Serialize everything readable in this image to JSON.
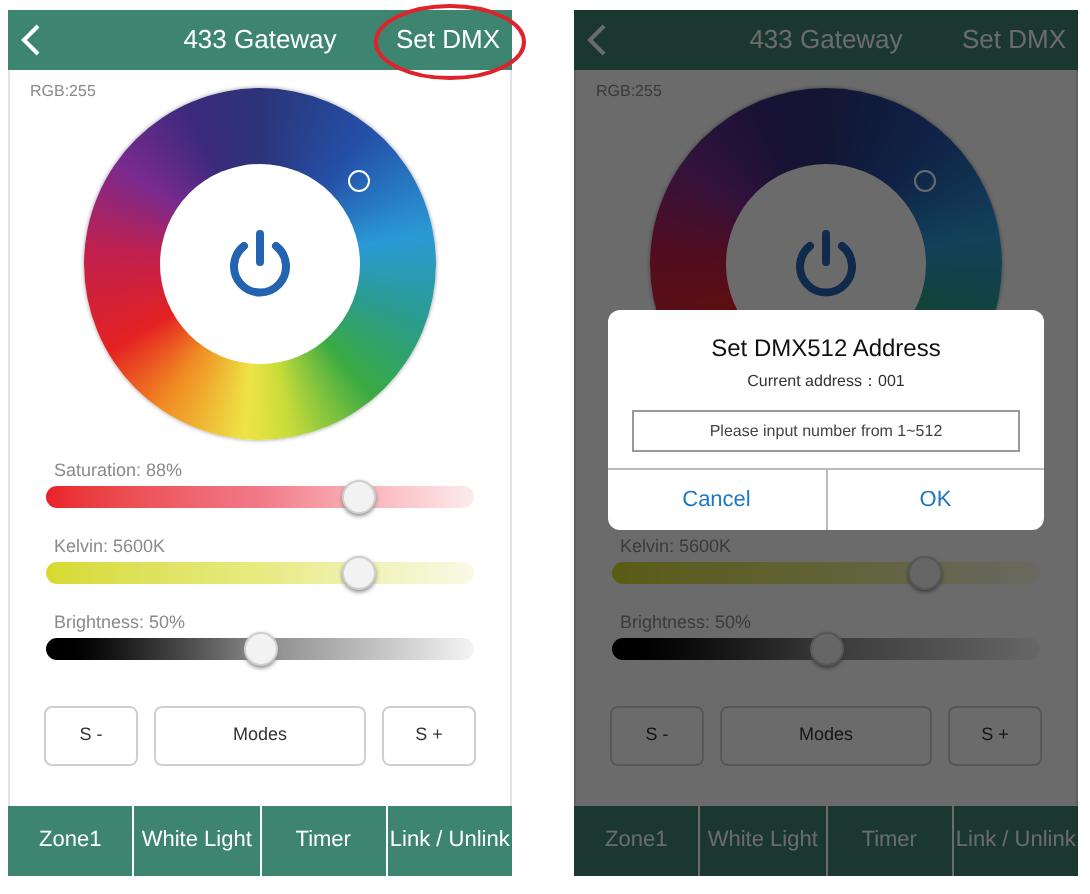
{
  "screens": [
    {
      "header": {
        "title": "433 Gateway",
        "action": "Set DMX",
        "action_highlighted": true
      },
      "rgb_label": "RGB:255",
      "sliders": [
        {
          "kind": "saturation",
          "label": "Saturation: 88%",
          "level": 0.73
        },
        {
          "kind": "kelvin",
          "label": "Kelvin: 5600K",
          "level": 0.73
        },
        {
          "kind": "brightness",
          "label": "Brightness: 50%",
          "level": 0.5
        }
      ],
      "buttons": [
        "S -",
        "Modes",
        "S +"
      ],
      "tabs": [
        "Zone1",
        "White Light",
        "Timer",
        "Link / Unlink"
      ]
    },
    {
      "header": {
        "title": "433 Gateway",
        "action": "Set DMX",
        "action_highlighted": false
      },
      "rgb_label": "RGB:255",
      "sliders": [
        {
          "kind": "kelvin",
          "label": "Kelvin: 5600K",
          "level": 0.73
        },
        {
          "kind": "brightness",
          "label": "Brightness: 50%",
          "level": 0.5
        }
      ],
      "buttons": [
        "S -",
        "Modes",
        "S +"
      ],
      "tabs": [
        "Zone1",
        "White Light",
        "Timer",
        "Link / Unlink"
      ],
      "dialog": {
        "title": "Set DMX512 Address",
        "subtitle": "Current address：001",
        "input": {
          "placeholder": "Please input number from 1~512"
        },
        "buttons": [
          "Cancel",
          "OK"
        ]
      }
    }
  ]
}
